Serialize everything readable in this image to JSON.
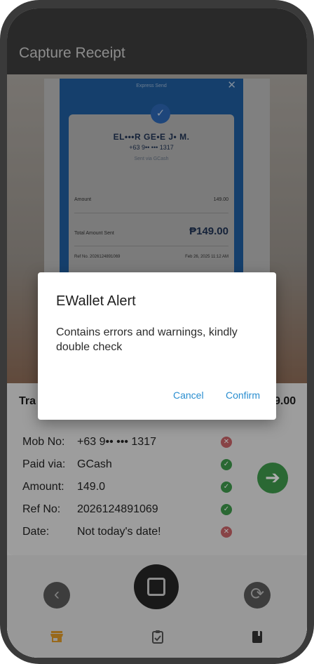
{
  "app_bar": {
    "title": "Capture Receipt"
  },
  "receipt": {
    "header": "Express Send",
    "name": "EL•••R GE•E J• M.",
    "number": "+63 9•• ••• 1317",
    "sent_via": "Sent via GCash",
    "amount_label": "Amount",
    "amount_value": "149.00",
    "total_label": "Total Amount Sent",
    "total_value": "₱149.00",
    "ref_label": "Ref No. 2026124891069",
    "date_value": "Feb 26, 2025 11:12 AM"
  },
  "result": {
    "transaction_label": "Tra",
    "transaction_amount": "9.00",
    "fields": [
      {
        "label": "Mob No:",
        "value": "+63 9•• ••• 1317",
        "status": "error"
      },
      {
        "label": "Paid via:",
        "value": "GCash",
        "status": "ok"
      },
      {
        "label": "Amount:",
        "value": "149.0",
        "status": "ok"
      },
      {
        "label": "Ref No:",
        "value": "2026124891069",
        "status": "ok"
      },
      {
        "label": "Date:",
        "value": "Not today's date!",
        "status": "error"
      }
    ]
  },
  "dialog": {
    "title": "EWallet Alert",
    "message": "Contains errors and warnings, kindly double check",
    "cancel_label": "Cancel",
    "confirm_label": "Confirm"
  },
  "icons": {
    "back": "chevron-left-icon",
    "capture": "camera-capture-icon",
    "refresh": "refresh-icon",
    "next": "arrow-right-icon",
    "nav": [
      "store-icon",
      "clipboard-check-icon",
      "book-icon"
    ]
  },
  "colors": {
    "accent": "#2a8ed0",
    "ok": "#3f9a4c",
    "error": "#c96468",
    "nav_active": "#e09b2a"
  }
}
